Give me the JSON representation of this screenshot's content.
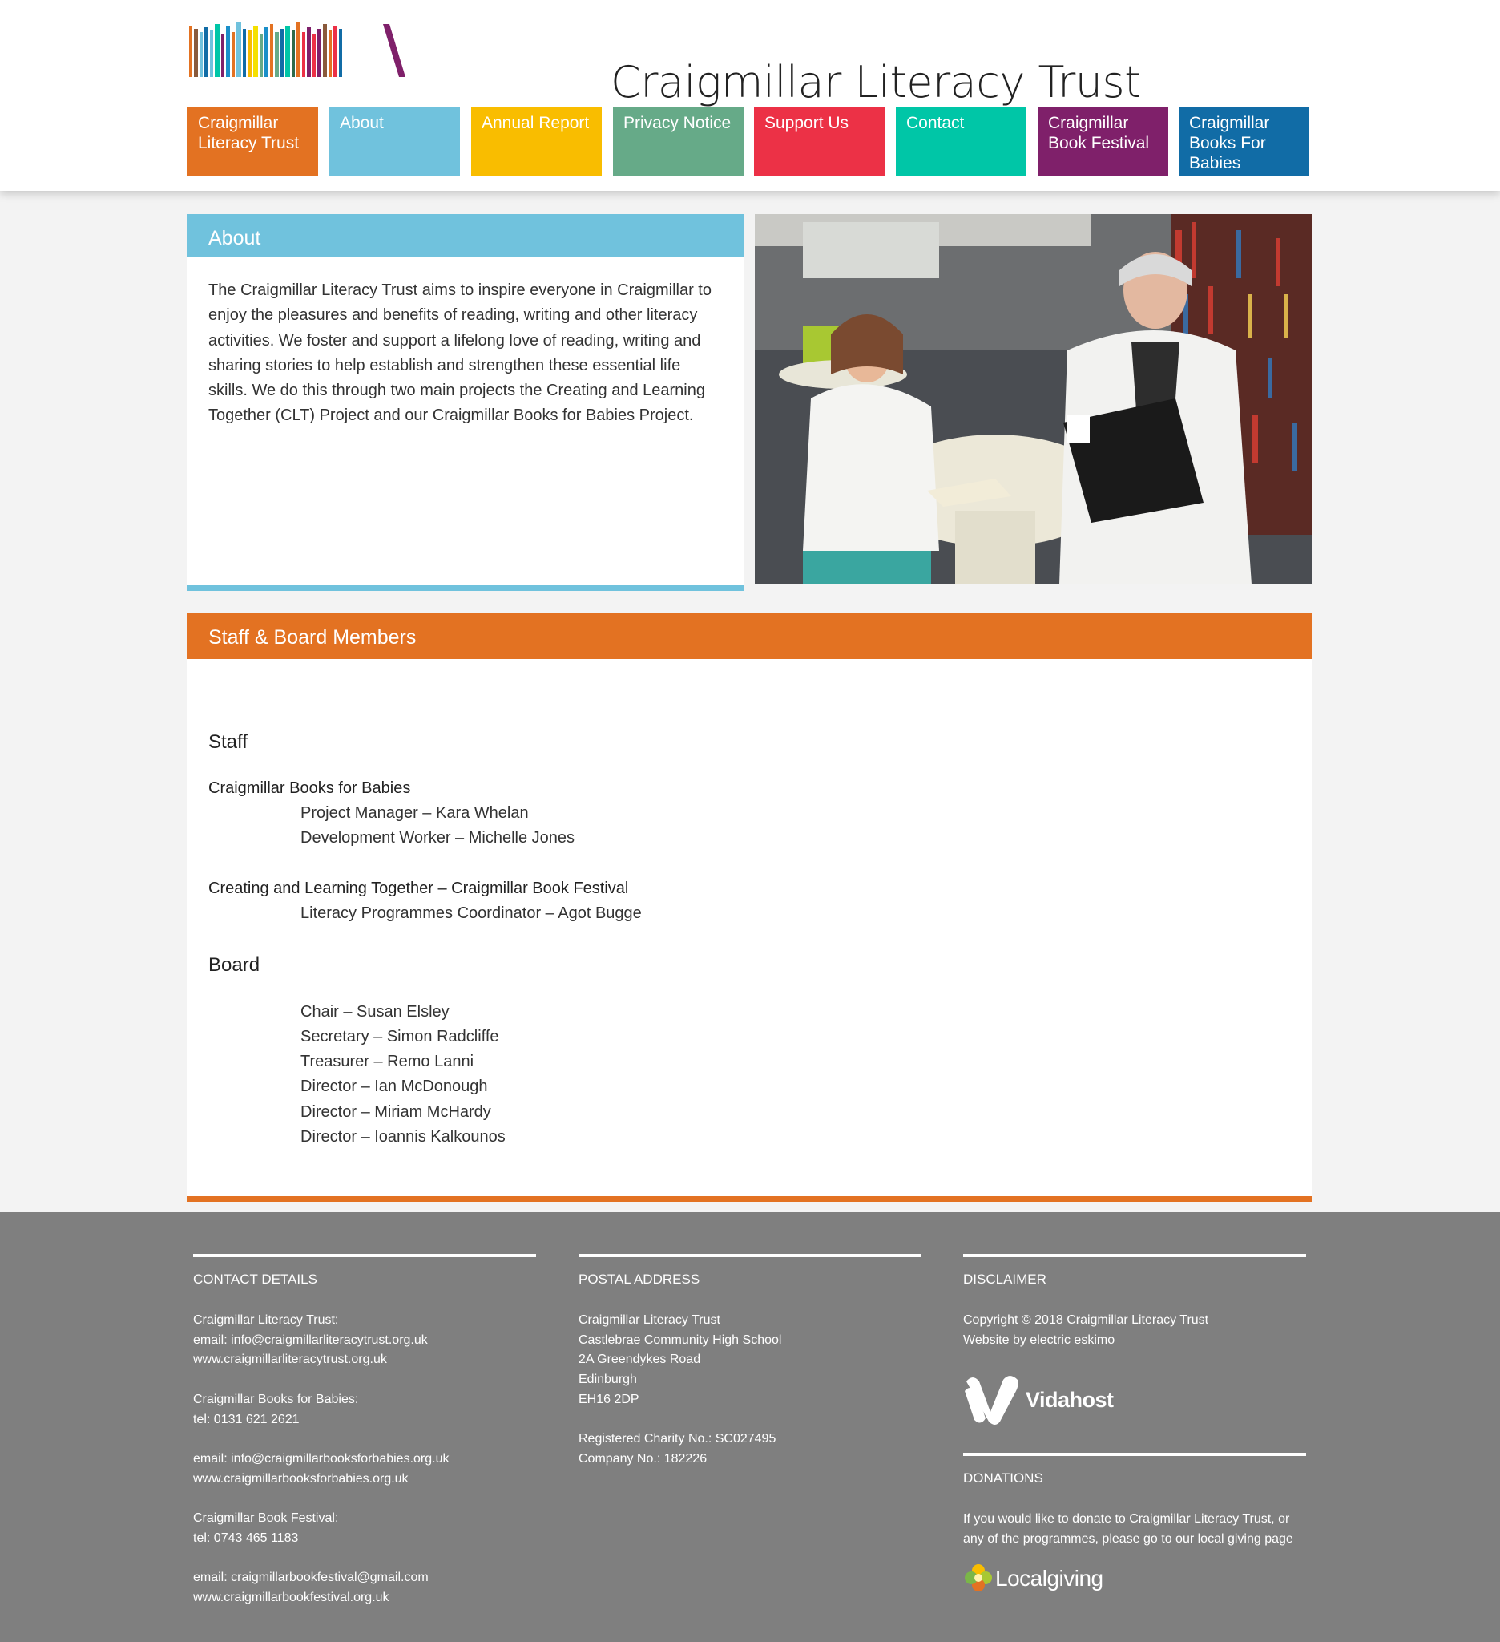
{
  "site": {
    "title": "Craigmillar Literacy Trust"
  },
  "nav": [
    {
      "label": "Craigmillar Literacy Trust",
      "color": "#e37222"
    },
    {
      "label": "About",
      "color": "#70c2dd"
    },
    {
      "label": "Annual Report",
      "color": "#f9bd00"
    },
    {
      "label": "Privacy Notice",
      "color": "#66aa88"
    },
    {
      "label": "Support Us",
      "color": "#ec3146"
    },
    {
      "label": "Contact",
      "color": "#00c6a7"
    },
    {
      "label": "Craigmillar Book Festival",
      "color": "#7f206a"
    },
    {
      "label": "Craigmillar Books For Babies",
      "color": "#116ca6"
    }
  ],
  "about": {
    "heading": "About",
    "text": "The Craigmillar Literacy Trust aims to inspire everyone in Craigmillar to enjoy the pleasures and benefits of reading, writing and other literacy activities. We foster and support a lifelong love of reading, writing and sharing stories to help establish and strengthen these essential life skills. We do this through two main projects the Creating and Learning Together (CLT) Project and our Craigmillar Books for Babies Project."
  },
  "staff_section": {
    "heading": "Staff & Board Members",
    "staff_heading": "Staff",
    "group1_title": "Craigmillar Books for Babies",
    "group1_lines": [
      "Project Manager – Kara Whelan",
      "Development Worker – Michelle Jones"
    ],
    "group2_title": "Creating and Learning Together – Craigmillar Book Festival",
    "group2_lines": [
      "Literacy Programmes Coordinator – Agot Bugge"
    ],
    "board_heading": "Board",
    "board_lines": [
      "Chair – Susan Elsley",
      "Secretary – Simon Radcliffe",
      "Treasurer – Remo Lanni",
      "Director – Ian McDonough",
      "Director – Miriam McHardy",
      "Director – Ioannis Kalkounos"
    ]
  },
  "footer": {
    "contact_heading": "CONTACT DETAILS",
    "contact_lines": [
      "Craigmillar Literacy Trust:",
      "email: info@craigmillarliteracytrust.org.uk",
      "www.craigmillarliteracytrust.org.uk",
      "",
      "Craigmillar Books for Babies:",
      "tel: 0131 621 2621",
      "",
      "email: info@craigmillarbooksforbabies.org.uk",
      "www.craigmillarbooksforbabies.org.uk",
      "",
      "Craigmillar Book Festival:",
      "tel: 0743 465 1183",
      "",
      "email: craigmillarbookfestival@gmail.com",
      "www.craigmillarbookfestival.org.uk"
    ],
    "postal_heading": "POSTAL ADDRESS",
    "postal_lines": [
      "Craigmillar Literacy Trust",
      "Castlebrae Community High School",
      "2A Greendykes Road",
      "Edinburgh",
      "EH16 2DP",
      "",
      "Registered Charity No.: SC027495",
      "Company No.: 182226"
    ],
    "disclaimer_heading": "DISCLAIMER",
    "disclaimer_lines": [
      "Copyright © 2018 Craigmillar Literacy Trust",
      "Website by electric eskimo"
    ],
    "vidahost_label": "Vidahost",
    "donations_heading": "DONATIONS",
    "donations_lines": [
      "If you would like to donate to Craigmillar Literacy Trust, or",
      "any of the programmes, please go to our local giving page"
    ],
    "localgiving_label": "Localgiving"
  }
}
